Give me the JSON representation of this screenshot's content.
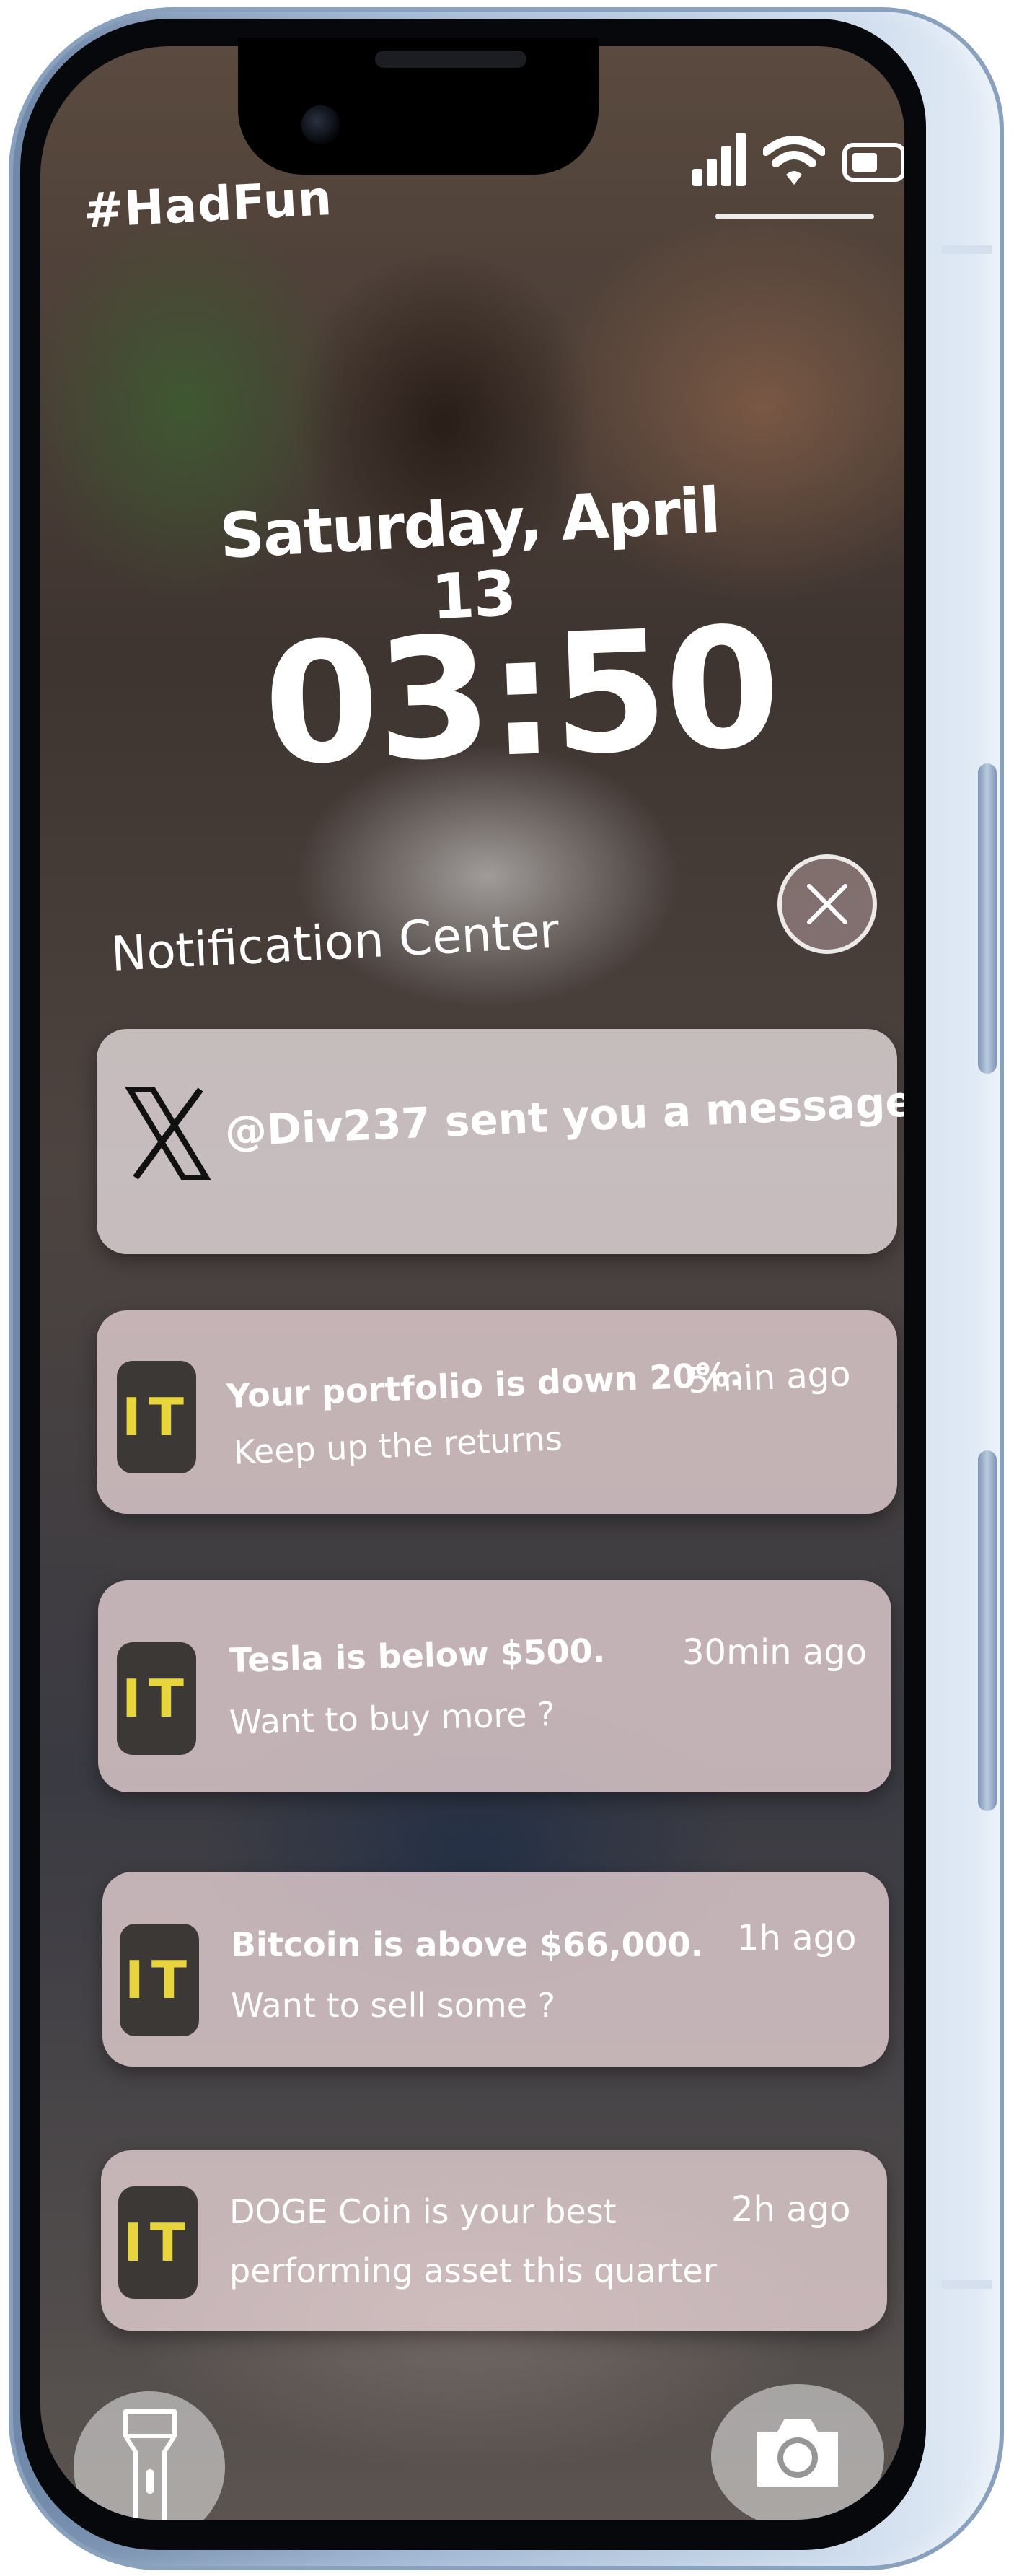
{
  "status_bar": {
    "signal_icon": "cellular-signal-icon",
    "wifi_icon": "wifi-icon",
    "battery_icon": "battery-icon"
  },
  "lock_screen": {
    "hashtag": "#HadFun",
    "date": "Saturday, April 13",
    "time": "03:50"
  },
  "notification_center": {
    "title": "Notification Center",
    "close_icon": "close-icon",
    "notifications": [
      {
        "app_icon": "x-logo-icon",
        "message": "@Div237 sent you a message"
      },
      {
        "app_icon_text": "IT",
        "line1": "Your portfolio is down 20%.",
        "line2": "Keep up the returns",
        "time": "5min ago"
      },
      {
        "app_icon_text": "IT",
        "line1": "Tesla  is below $500.",
        "line2": "Want to buy more ?",
        "time": "30min ago"
      },
      {
        "app_icon_text": "IT",
        "line1": "Bitcoin is above $66,000.",
        "line2": "Want to sell some ?",
        "time": "1h ago"
      },
      {
        "app_icon_text": "IT",
        "line1": "DOGE Coin is your best",
        "line2": "performing asset this quarter",
        "time": "2h ago"
      }
    ]
  },
  "quick_actions": {
    "flashlight_icon": "flashlight-icon",
    "camera_icon": "camera-icon"
  },
  "colors": {
    "phone_frame": "#9fb6d2",
    "app_icon_bg": "#3b3836",
    "app_icon_text": "#e8d43c",
    "card_bg": "#e8d4d6"
  }
}
